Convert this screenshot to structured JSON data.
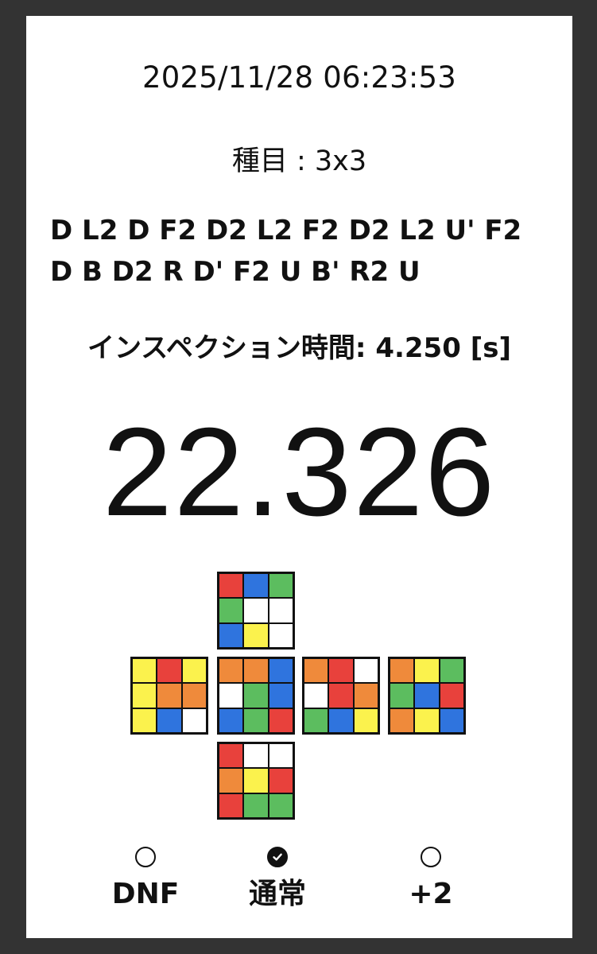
{
  "record": {
    "datetime": "2025/11/28 06:23:53",
    "event": "種目 : 3x3",
    "scramble_lines": [
      "D L2 D F2 D2 L2 F2 D2 L2 U' F2",
      "D B D2 R D' F2 U B' R2 U"
    ],
    "inspection": "インスペクション時間: 4.250 [s]",
    "time": "22.326"
  },
  "colors": {
    "R": "#e8413c",
    "B": "#2f74de",
    "G": "#5cbd5f",
    "W": "#ffffff",
    "Y": "#fbf24d",
    "O": "#ef8a3b"
  },
  "cube": {
    "U": [
      "R",
      "B",
      "G",
      "G",
      "W",
      "W",
      "B",
      "Y",
      "W"
    ],
    "L": [
      "Y",
      "R",
      "Y",
      "Y",
      "O",
      "O",
      "Y",
      "B",
      "W"
    ],
    "F": [
      "O",
      "O",
      "B",
      "W",
      "G",
      "B",
      "B",
      "G",
      "R"
    ],
    "R": [
      "O",
      "R",
      "W",
      "W",
      "R",
      "O",
      "G",
      "B",
      "Y"
    ],
    "B": [
      "O",
      "Y",
      "G",
      "G",
      "B",
      "R",
      "O",
      "Y",
      "B"
    ],
    "D": [
      "R",
      "W",
      "W",
      "O",
      "Y",
      "R",
      "R",
      "G",
      "G"
    ]
  },
  "penalties": [
    {
      "label": "DNF",
      "checked": false
    },
    {
      "label": "通常",
      "checked": true
    },
    {
      "label": "+2",
      "checked": false
    }
  ]
}
